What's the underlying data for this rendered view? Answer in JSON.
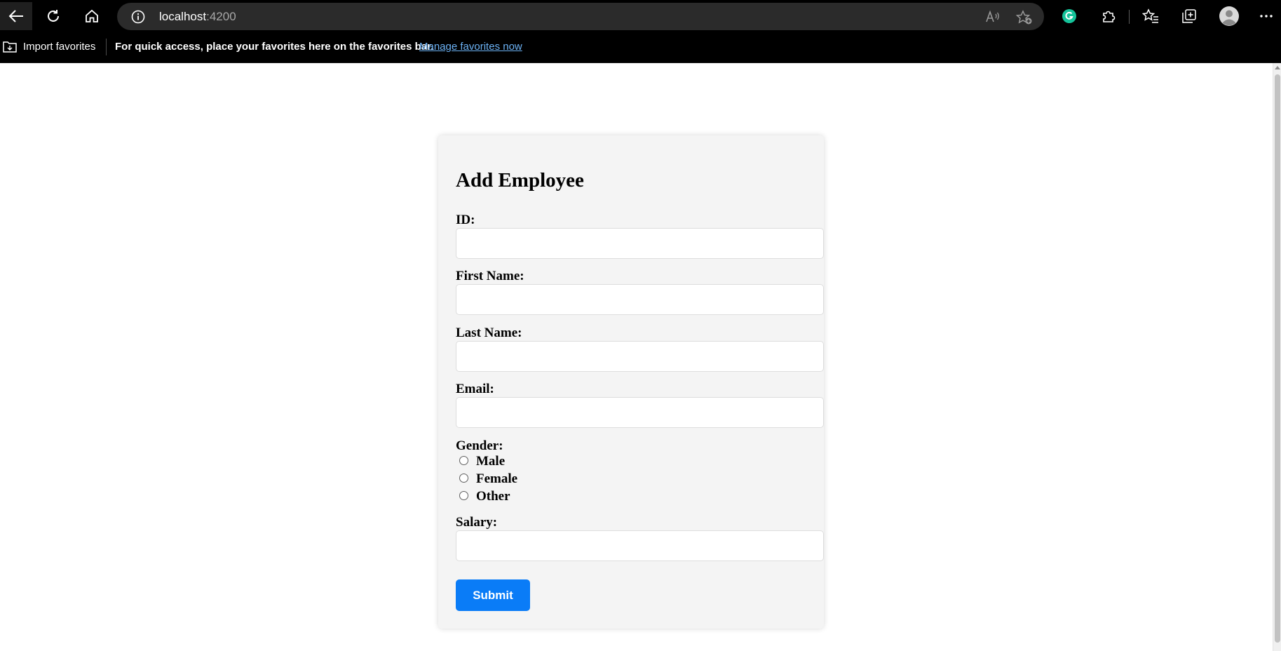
{
  "browser": {
    "url_host": "localhost",
    "url_port": ":4200",
    "icons": {
      "back": "back-arrow-icon",
      "refresh": "refresh-icon",
      "home": "home-icon",
      "site_info": "info-icon",
      "read_aloud": "read-aloud-icon",
      "favorite": "add-favorite-icon",
      "grammarly": "grammarly-icon",
      "extensions": "extensions-icon",
      "favorites": "favorites-icon",
      "collections": "collections-icon",
      "profile": "profile-icon",
      "more": "more-icon"
    }
  },
  "favorites_bar": {
    "import_label": "Import favorites",
    "message": "For quick access, place your favorites here on the favorites bar.",
    "manage_link": "Manage favorites now"
  },
  "form": {
    "title": "Add Employee",
    "fields": {
      "id": {
        "label": "ID:",
        "value": ""
      },
      "first_name": {
        "label": "First Name:",
        "value": ""
      },
      "last_name": {
        "label": "Last Name:",
        "value": ""
      },
      "email": {
        "label": "Email:",
        "value": ""
      },
      "salary": {
        "label": "Salary:",
        "value": ""
      }
    },
    "gender": {
      "label": "Gender:",
      "options": [
        "Male",
        "Female",
        "Other"
      ],
      "selected": ""
    },
    "submit_label": "Submit"
  },
  "colors": {
    "submit_bg": "#0a7cf7",
    "card_bg": "#f4f4f4",
    "link": "#6cb2f5"
  }
}
